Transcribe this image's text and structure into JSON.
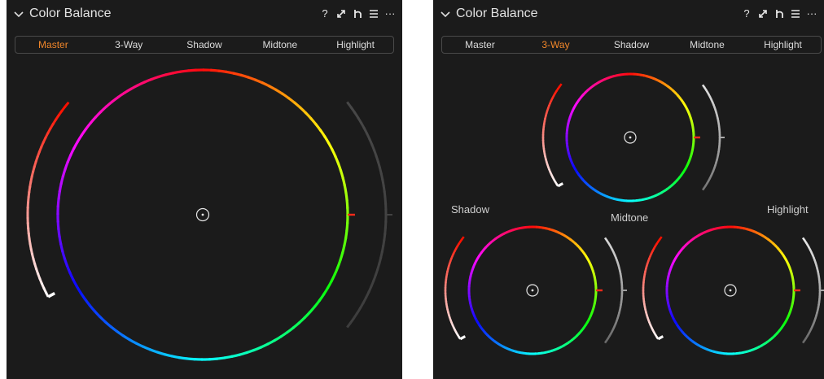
{
  "panels": [
    {
      "title": "Color Balance",
      "tabs": [
        "Master",
        "3-Way",
        "Shadow",
        "Midtone",
        "Highlight"
      ],
      "active_tab": "Master",
      "tools": {
        "help": "?",
        "more": "···"
      }
    },
    {
      "title": "Color Balance",
      "tabs": [
        "Master",
        "3-Way",
        "Shadow",
        "Midtone",
        "Highlight"
      ],
      "active_tab": "3-Way",
      "tools": {
        "help": "?",
        "more": "···"
      },
      "wheel_labels": {
        "shadow": "Shadow",
        "midtone": "Midtone",
        "highlight": "Highlight"
      }
    }
  ],
  "colors": {
    "accent": "#f0862a",
    "panel_bg": "#1b1b1b",
    "tab_border": "#4a4a4a"
  },
  "icons": [
    "chevron-down-icon",
    "help-icon",
    "expand-icon",
    "reset-icon",
    "menu-icon",
    "more-icon",
    "wheel-center-icon"
  ]
}
